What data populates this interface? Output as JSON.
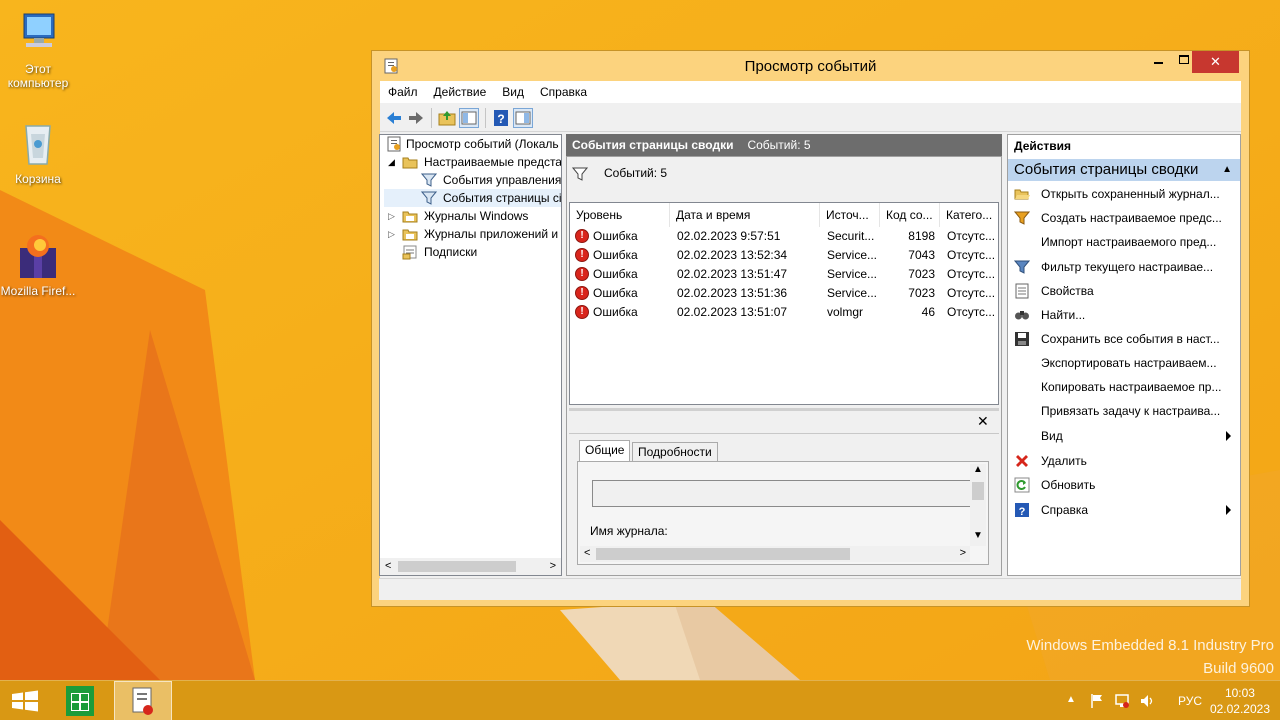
{
  "desktop": {
    "icons": [
      {
        "label": "Этот компьютер",
        "icon": "computer-icon"
      },
      {
        "label": "Корзина",
        "icon": "recycle-bin-icon"
      },
      {
        "label": "Mozilla Firef...",
        "icon": "firefox-icon"
      }
    ],
    "watermark": {
      "line1": "Windows Embedded 8.1 Industry Pro",
      "line2": "Build 9600"
    }
  },
  "window": {
    "title": "Просмотр событий",
    "controls": {
      "minimize": "minimize-icon",
      "maximize": "maximize-icon",
      "close": "✕"
    },
    "menu": [
      "Файл",
      "Действие",
      "Вид",
      "Справка"
    ],
    "toolbar": [
      "back-arrow-icon",
      "forward-arrow-icon",
      "folder-up-icon",
      "show-hide-tree-icon",
      "help-icon",
      "show-hide-action-pane-icon"
    ]
  },
  "tree": {
    "items": [
      {
        "label": "Просмотр событий (Локаль",
        "icon": "event-viewer-icon",
        "expander": ""
      },
      {
        "label": "Настраиваемые предста",
        "icon": "folder-icon",
        "expander": "◢"
      },
      {
        "label": "События управления",
        "icon": "filter-icon",
        "expander": ""
      },
      {
        "label": "События страницы сі",
        "icon": "filter-icon",
        "expander": ""
      },
      {
        "label": "Журналы Windows",
        "icon": "folder-icon",
        "expander": "▷"
      },
      {
        "label": "Журналы приложений и",
        "icon": "folder-icon",
        "expander": "▷"
      },
      {
        "label": "Подписки",
        "icon": "subscriptions-icon",
        "expander": ""
      }
    ]
  },
  "center": {
    "header_title": "События страницы сводки",
    "header_count": "Событий: 5",
    "filter_label": "Событий: 5",
    "columns": [
      "Уровень",
      "Дата и время",
      "Источ...",
      "Код со...",
      "Катего..."
    ],
    "rows": [
      {
        "level": "Ошибка",
        "datetime": "02.02.2023 9:57:51",
        "source": "Securit...",
        "code": "8198",
        "category": "Отсутс..."
      },
      {
        "level": "Ошибка",
        "datetime": "02.02.2023 13:52:34",
        "source": "Service...",
        "code": "7043",
        "category": "Отсутс..."
      },
      {
        "level": "Ошибка",
        "datetime": "02.02.2023 13:51:47",
        "source": "Service...",
        "code": "7023",
        "category": "Отсутс..."
      },
      {
        "level": "Ошибка",
        "datetime": "02.02.2023 13:51:36",
        "source": "Service...",
        "code": "7023",
        "category": "Отсутс..."
      },
      {
        "level": "Ошибка",
        "datetime": "02.02.2023 13:51:07",
        "source": "volmgr",
        "code": "46",
        "category": "Отсутс..."
      }
    ],
    "details": {
      "tabs": [
        "Общие",
        "Подробности"
      ],
      "log_name_label": "Имя журнала:"
    }
  },
  "actions": {
    "title": "Действия",
    "section": "События страницы сводки",
    "items": [
      {
        "label": "Открыть сохраненный журнал...",
        "icon": "open-folder-icon"
      },
      {
        "label": "Создать настраиваемое предс...",
        "icon": "create-filter-icon"
      },
      {
        "label": "Импорт настраиваемого пред...",
        "icon": ""
      },
      {
        "label": "Фильтр текущего настраивае...",
        "icon": "filter-icon"
      },
      {
        "label": "Свойства",
        "icon": "properties-icon"
      },
      {
        "label": "Найти...",
        "icon": "find-icon"
      },
      {
        "label": "Сохранить все события в наст...",
        "icon": "save-icon"
      },
      {
        "label": "Экспортировать настраиваем...",
        "icon": ""
      },
      {
        "label": "Копировать настраиваемое пр...",
        "icon": ""
      },
      {
        "label": "Привязать задачу к настраива...",
        "icon": ""
      },
      {
        "label": "Вид",
        "icon": "",
        "submenu": true
      },
      {
        "label": "Удалить",
        "icon": "delete-icon"
      },
      {
        "label": "Обновить",
        "icon": "refresh-icon"
      },
      {
        "label": "Справка",
        "icon": "help-icon",
        "submenu": true
      }
    ]
  },
  "taskbar": {
    "start": "windows-start-icon",
    "pinned": [
      "store-icon",
      "event-viewer-icon"
    ],
    "language": "РУС",
    "time": "10:03",
    "date": "02.02.2023"
  }
}
